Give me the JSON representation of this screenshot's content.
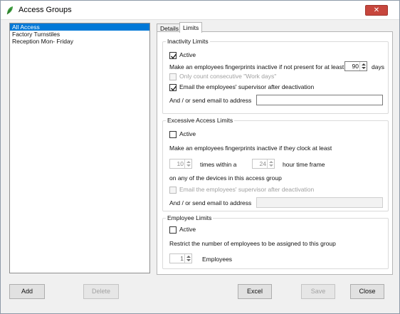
{
  "window": {
    "title": "Access Groups",
    "close_icon": "close-x-icon",
    "close_color": "#c7463d"
  },
  "groups_list": {
    "items": [
      {
        "label": "All Access",
        "selected": true
      },
      {
        "label": "Factory Turnstiles",
        "selected": false
      },
      {
        "label": "Reception Mon- Friday",
        "selected": false
      }
    ]
  },
  "tabs": [
    {
      "label": "Details",
      "active": false
    },
    {
      "label": "Limits",
      "active": true
    }
  ],
  "inactivity": {
    "title": "Inactivity Limits",
    "active_label": "Active",
    "active_checked": true,
    "inactive_text": "Make an employees fingerprints inactive if not present for at least",
    "days_value": "90",
    "days_label": "days",
    "workdays_label": "Only count consecutive \"Work days\"",
    "workdays_checked": false,
    "email_label": "Email the employees' supervisor after deactivation",
    "email_checked": true,
    "address_label": "And / or send email to address",
    "address_value": ""
  },
  "excessive": {
    "title": "Excessive Access Limits",
    "active_label": "Active",
    "active_checked": false,
    "inactive_text": "Make an employees fingerprints inactive if they clock at least",
    "times_value": "10",
    "times_label": "times within a",
    "hours_value": "24",
    "hours_label": "hour time frame",
    "devices_text": "on any of the devices in this access group",
    "email_label": "Email the employees' supervisor after deactivation",
    "email_checked": false,
    "address_label": "And / or send email to address",
    "address_value": ""
  },
  "employee": {
    "title": "Employee Limits",
    "active_label": "Active",
    "active_checked": false,
    "restrict_text": "Restrict the number of employees to be assigned to this group",
    "count_value": "1",
    "count_label": "Employees"
  },
  "buttons": {
    "add": "Add",
    "delete": "Delete",
    "excel": "Excel",
    "save": "Save",
    "close": "Close"
  }
}
